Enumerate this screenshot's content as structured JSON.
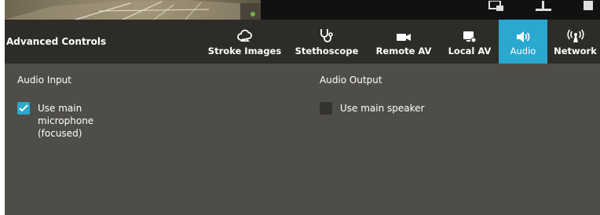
{
  "header": {
    "title": "Advanced Controls"
  },
  "tabs": [
    {
      "id": "stroke-images",
      "label": "Stroke Images",
      "icon": "cloud-image-icon",
      "active": false
    },
    {
      "id": "stethoscope",
      "label": "Stethoscope",
      "icon": "stethoscope-icon",
      "active": false
    },
    {
      "id": "remote-av",
      "label": "Remote AV",
      "icon": "video-camera-icon",
      "active": false
    },
    {
      "id": "local-av",
      "label": "Local AV",
      "icon": "monitor-camera-icon",
      "active": false
    },
    {
      "id": "audio",
      "label": "Audio",
      "icon": "speaker-icon",
      "active": true
    },
    {
      "id": "network",
      "label": "Network",
      "icon": "broadcast-icon",
      "active": false
    }
  ],
  "audio_input": {
    "title": "Audio Input",
    "option_line1": "Use main",
    "option_line2": "microphone",
    "option_line3": "(focused)",
    "checked": true
  },
  "audio_output": {
    "title": "Audio Output",
    "option_label": "Use main speaker",
    "checked": false
  },
  "colors": {
    "accent": "#2aa8cf",
    "header_bg": "#2d2c28",
    "content_bg": "#4f4d47",
    "checkbox_off": "#35332f"
  }
}
